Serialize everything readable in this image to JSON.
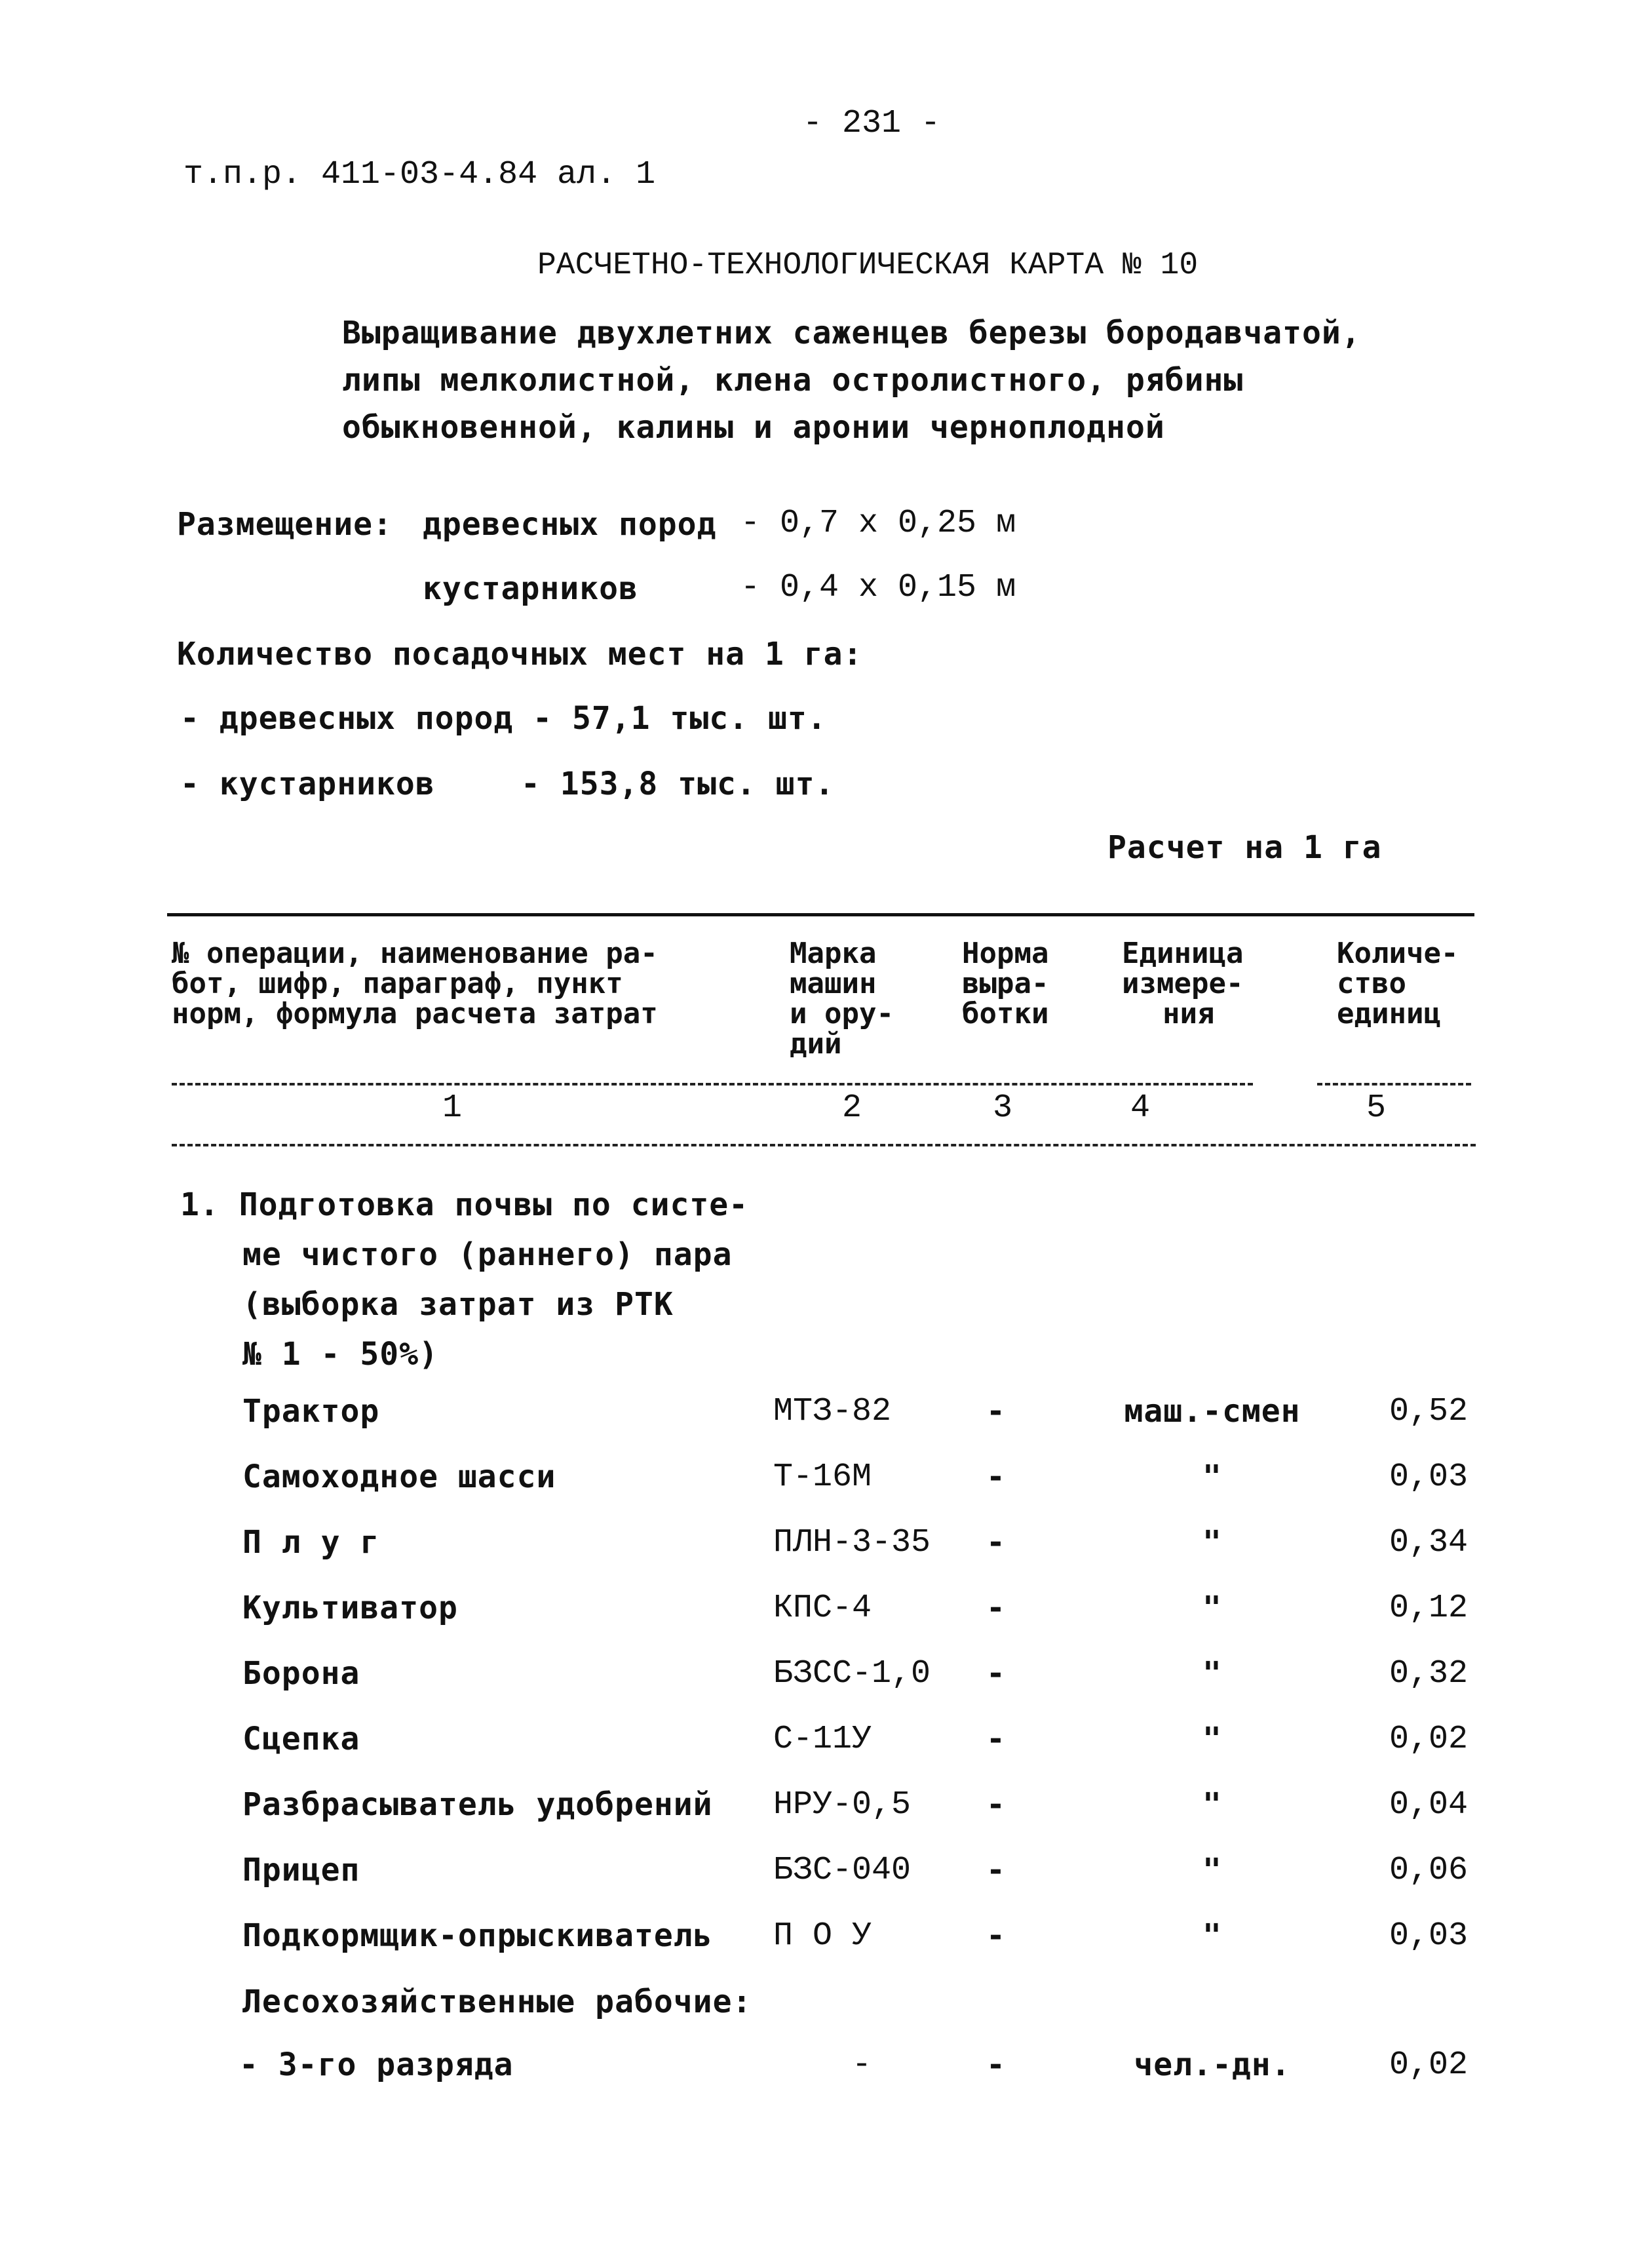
{
  "page_number": "- 231 -",
  "doc_reference": "т.п.р. 411-03-4.84 ал. 1",
  "title": "РАСЧЕТНО-ТЕХНОЛОГИЧЕСКАЯ КАРТА № 10",
  "subtitle_lines": [
    "Выращивание двухлетних саженцев березы бородавчатой,",
    "липы мелколистной, клена остролистного, рябины",
    "обыкновенной, калины и аронии черноплодной"
  ],
  "placement": {
    "label": "Размещение:",
    "trees_label": "древесных пород",
    "trees_value": "- 0,7 х 0,25 м",
    "shrubs_label": "кустарников",
    "shrubs_value": "- 0,4 х 0,15 м"
  },
  "planting_count": {
    "heading": "Количество посадочных мест на 1 га:",
    "trees": "- древесных пород - 57,1 тыс. шт.",
    "shrubs_label": "- кустарников",
    "shrubs_value": "- 153,8 тыс. шт."
  },
  "calc_basis": "Расчет на 1 га",
  "table": {
    "headers": [
      [
        "№ операции, наименование ра-",
        "бот, шифр, параграф, пункт",
        "норм, формула расчета затрат"
      ],
      [
        "Марка",
        "машин",
        "и ору-",
        "дий"
      ],
      [
        "Норма",
        "выра-",
        "ботки"
      ],
      [
        "Единица",
        "измере-",
        "ния"
      ],
      [
        "Количе-",
        "ство",
        "единиц"
      ]
    ],
    "column_numbers": [
      "1",
      "2",
      "3",
      "4",
      "5"
    ],
    "section": {
      "lines": [
        "1. Подготовка почвы по систе-",
        "ме чистого (раннего) пара",
        "(выборка затрат из РТК",
        "№ 1 - 50%)"
      ]
    },
    "rows": [
      {
        "name": "Трактор",
        "mark": "МТЗ-82",
        "norm": "-",
        "unit": "маш.-смен",
        "qty": "0,52"
      },
      {
        "name": "Самоходное шасси",
        "mark": "Т-16М",
        "norm": "-",
        "unit": "\"",
        "qty": "0,03"
      },
      {
        "name": "П л у г",
        "mark": "ПЛН-3-35",
        "norm": "-",
        "unit": "\"",
        "qty": "0,34"
      },
      {
        "name": "Культиватор",
        "mark": "КПС-4",
        "norm": "-",
        "unit": "\"",
        "qty": "0,12"
      },
      {
        "name": "Борона",
        "mark": "БЗСС-1,0",
        "norm": "-",
        "unit": "\"",
        "qty": "0,32"
      },
      {
        "name": "Сцепка",
        "mark": "С-11У",
        "norm": "-",
        "unit": "\"",
        "qty": "0,02"
      },
      {
        "name": "Разбрасыватель удобрений",
        "mark": "НРУ-0,5",
        "norm": "-",
        "unit": "\"",
        "qty": "0,04"
      },
      {
        "name": "Прицеп",
        "mark": "БЗС-040",
        "norm": "-",
        "unit": "\"",
        "qty": "0,06"
      },
      {
        "name": "Подкормщик-опрыскиватель",
        "mark": "П О У",
        "norm": "-",
        "unit": "\"",
        "qty": "0,03"
      }
    ],
    "workers_label": "Лесохозяйственные рабочие:",
    "workers_rows": [
      {
        "name": "- 3-го разряда",
        "mark": "-",
        "norm": "-",
        "unit": "чел.-дн.",
        "qty": "0,02"
      }
    ]
  }
}
